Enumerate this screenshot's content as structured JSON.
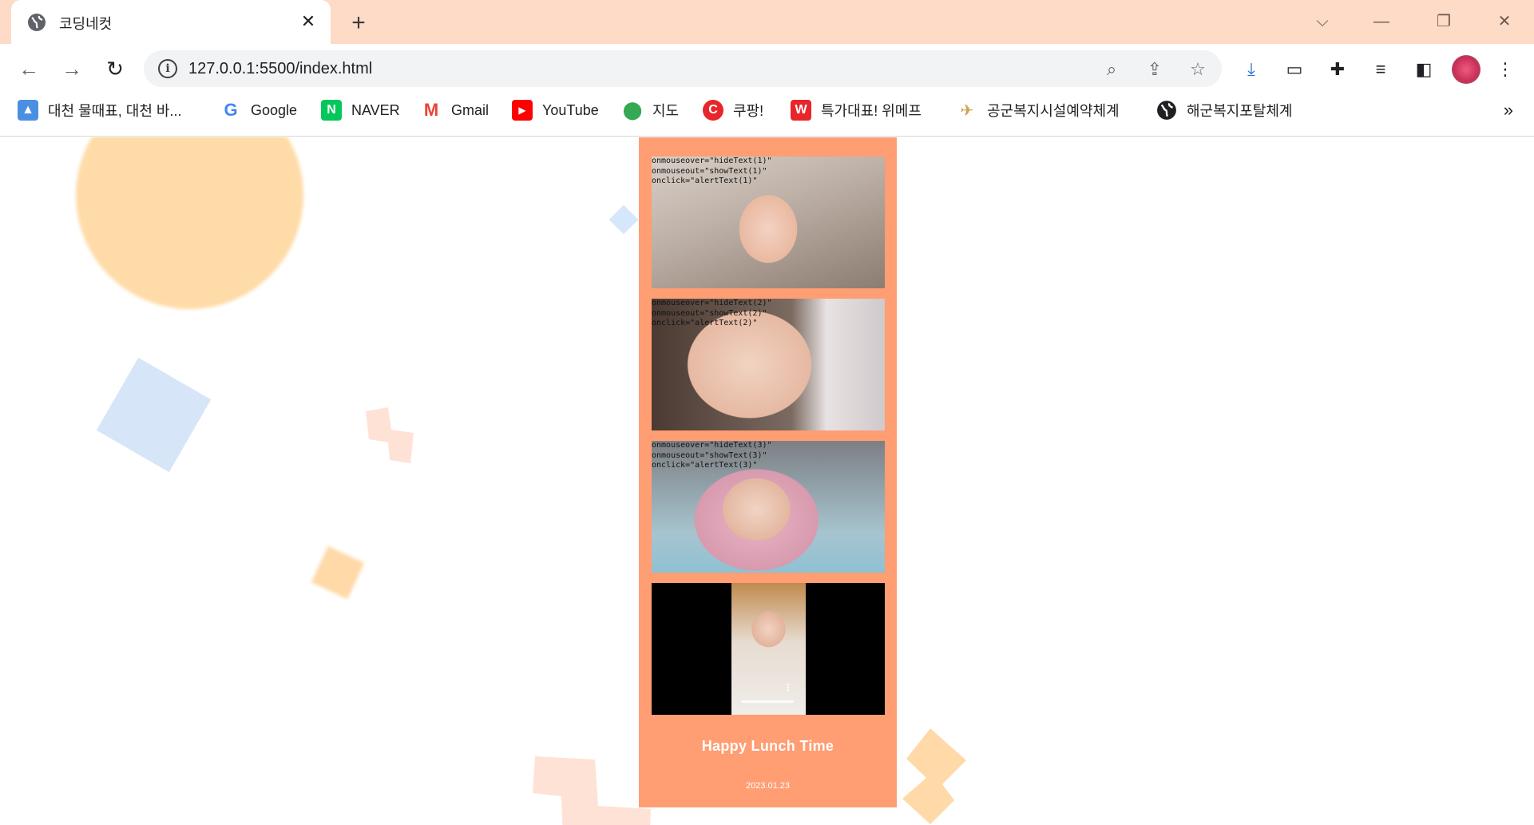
{
  "browser": {
    "tab_title": "코딩네컷",
    "url": "127.0.0.1:5500/index.html",
    "colors": {
      "titlebar": "#fddbc6",
      "accent": "#ff9d73"
    }
  },
  "bookmarks": [
    {
      "label": "대천 물때표, 대천 바...",
      "icon": "image-icon"
    },
    {
      "label": "Google",
      "icon": "google-icon"
    },
    {
      "label": "NAVER",
      "icon": "naver-icon"
    },
    {
      "label": "Gmail",
      "icon": "gmail-icon"
    },
    {
      "label": "YouTube",
      "icon": "youtube-icon"
    },
    {
      "label": "지도",
      "icon": "maps-icon"
    },
    {
      "label": "쿠팡!",
      "icon": "coupang-icon"
    },
    {
      "label": "특가대표! 위메프",
      "icon": "wemakeprice-icon"
    },
    {
      "label": "공군복지시설예약체계",
      "icon": "airforce-icon"
    },
    {
      "label": "해군복지포탈체계",
      "icon": "globe-icon"
    }
  ],
  "card": {
    "photos": [
      {
        "code": "onmouseover=\"hideText(1)\"\nonmouseout=\"showText(1)\"\nonclick=\"alertText(1)\""
      },
      {
        "code": "onmouseover=\"hideText(2)\"\nonmouseout=\"showText(2)\"\nonclick=\"alertText(2)\""
      },
      {
        "code": "onmouseover=\"hideText(3)\"\nonmouseout=\"showText(3)\"\nonclick=\"alertText(3)\""
      }
    ],
    "title": "Happy Lunch Time",
    "date": "2023.01.23"
  }
}
